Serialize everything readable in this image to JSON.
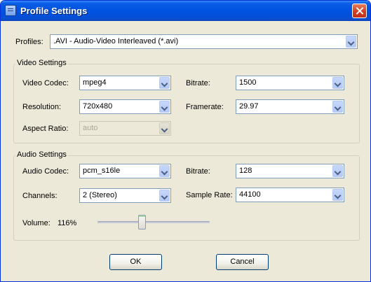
{
  "window": {
    "title": "Profile Settings"
  },
  "profiles": {
    "label": "Profiles:",
    "value": ".AVI - Audio-Video Interleaved (*.avi)"
  },
  "video": {
    "group_title": "Video Settings",
    "codec_label": "Video Codec:",
    "codec_value": "mpeg4",
    "bitrate_label": "Bitrate:",
    "bitrate_value": "1500",
    "resolution_label": "Resolution:",
    "resolution_value": "720x480",
    "framerate_label": "Framerate:",
    "framerate_value": "29.97",
    "aspect_label": "Aspect Ratio:",
    "aspect_value": "auto"
  },
  "audio": {
    "group_title": "Audio Settings",
    "codec_label": "Audio Codec:",
    "codec_value": "pcm_s16le",
    "bitrate_label": "Bitrate:",
    "bitrate_value": "128",
    "channels_label": "Channels:",
    "channels_value": "2 (Stereo)",
    "samplerate_label": "Sample Rate:",
    "samplerate_value": "44100",
    "volume_label": "Volume:",
    "volume_value": "116%"
  },
  "buttons": {
    "ok": "OK",
    "cancel": "Cancel"
  },
  "icons": {
    "app": "window-icon",
    "close": "close-icon",
    "dropdown": "chevron-down-icon"
  }
}
